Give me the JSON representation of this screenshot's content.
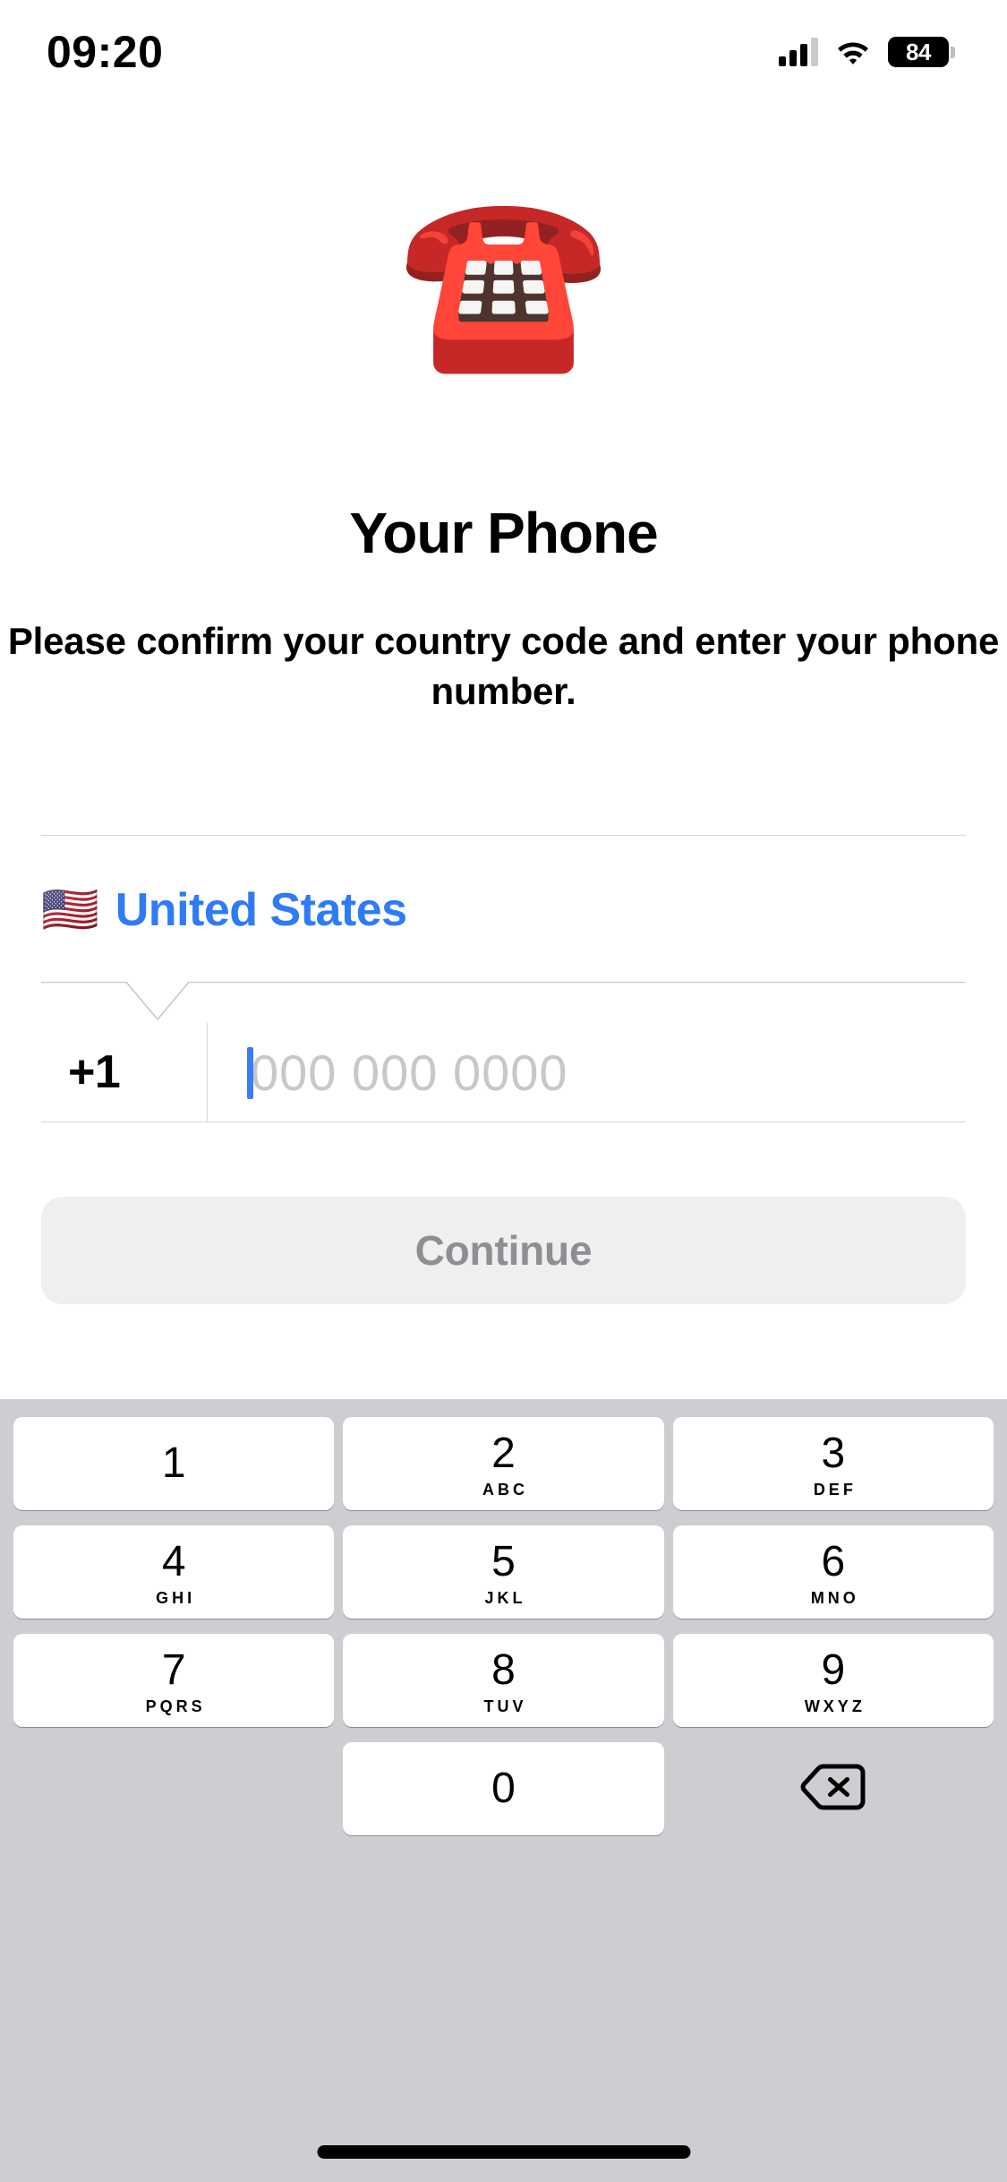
{
  "status_bar": {
    "time": "09:20",
    "battery_percent": "84",
    "signal_icon": "cellular-bars-icon",
    "wifi_icon": "wifi-icon",
    "battery_icon": "battery-icon"
  },
  "hero": {
    "emoji": "☎️",
    "emoji_name": "telephone-emoji"
  },
  "page": {
    "title": "Your Phone",
    "subtitle": "Please confirm your country code and enter your phone number."
  },
  "country_selector": {
    "flag": "🇺🇸",
    "name": "United States"
  },
  "phone_input": {
    "dial_code": "+1",
    "value": "",
    "placeholder": "000 000 0000"
  },
  "continue_button": {
    "label": "Continue",
    "enabled": false,
    "background": "#EFEFF0",
    "text_color": "#8E8E93"
  },
  "colors": {
    "accent_blue": "#2F7BF6",
    "caret_blue": "#3C7DF5",
    "placeholder_gray": "#C7C7CC",
    "keypad_background": "#CDCED2",
    "key_white": "#FFFFFF",
    "divider": "#D6D6D8"
  },
  "keypad": {
    "rows": [
      [
        {
          "digit": "1",
          "letters": ""
        },
        {
          "digit": "2",
          "letters": "ABC"
        },
        {
          "digit": "3",
          "letters": "DEF"
        }
      ],
      [
        {
          "digit": "4",
          "letters": "GHI"
        },
        {
          "digit": "5",
          "letters": "JKL"
        },
        {
          "digit": "6",
          "letters": "MNO"
        }
      ],
      [
        {
          "digit": "7",
          "letters": "PQRS"
        },
        {
          "digit": "8",
          "letters": "TUV"
        },
        {
          "digit": "9",
          "letters": "WXYZ"
        }
      ]
    ],
    "zero_key": {
      "digit": "0",
      "letters": ""
    },
    "backspace_label": "delete-left"
  }
}
